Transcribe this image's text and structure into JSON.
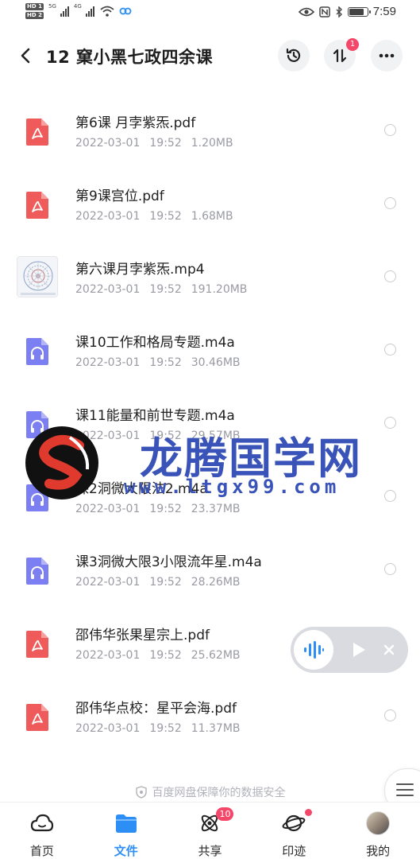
{
  "status_bar": {
    "hd1": "HD 1",
    "hd2": "HD 2",
    "net1": "5G",
    "net2": "4G",
    "time": "7:59"
  },
  "header": {
    "title": "12 窠小黑七政四余课",
    "sort_badge": "1"
  },
  "files": [
    {
      "name": "第6课 月孛紫炁.pdf",
      "date": "2022-03-01",
      "time": "19:52",
      "size": "1.20MB",
      "type": "pdf"
    },
    {
      "name": "第9课宫位.pdf",
      "date": "2022-03-01",
      "time": "19:52",
      "size": "1.68MB",
      "type": "pdf"
    },
    {
      "name": "第六课月孛紫炁.mp4",
      "date": "2022-03-01",
      "time": "19:52",
      "size": "191.20MB",
      "type": "video"
    },
    {
      "name": "课10工作和格局专题.m4a",
      "date": "2022-03-01",
      "time": "19:52",
      "size": "30.46MB",
      "type": "audio"
    },
    {
      "name": "课11能量和前世专题.m4a",
      "date": "2022-03-01",
      "time": "19:52",
      "size": "29.57MB",
      "type": "audio"
    },
    {
      "name": "课2洞微大限法2.m4a",
      "date": "2022-03-01",
      "time": "19:52",
      "size": "23.37MB",
      "type": "audio"
    },
    {
      "name": "课3洞微大限3小限流年星.m4a",
      "date": "2022-03-01",
      "time": "19:52",
      "size": "28.26MB",
      "type": "audio"
    },
    {
      "name": "邵伟华张果星宗上.pdf",
      "date": "2022-03-01",
      "time": "19:52",
      "size": "25.62MB",
      "type": "pdf"
    },
    {
      "name": "邵伟华点校：星平会海.pdf",
      "date": "2022-03-01",
      "time": "19:52",
      "size": "11.37MB",
      "type": "pdf"
    }
  ],
  "watermark": {
    "text": "龙腾国学网",
    "url": "www.ltgx99.com"
  },
  "safety_note": "百度网盘保障你的数据安全",
  "nav": {
    "items": [
      {
        "label": "首页",
        "icon": "cloud-home-icon"
      },
      {
        "label": "文件",
        "icon": "folder-icon"
      },
      {
        "label": "共享",
        "icon": "share-orbit-icon",
        "badge": "10"
      },
      {
        "label": "印迹",
        "icon": "planet-icon"
      },
      {
        "label": "我的",
        "icon": "avatar"
      }
    ]
  },
  "colors": {
    "accent": "#2d8ef6",
    "pdf": "#ef5a5a",
    "audio": "#7c7ff2",
    "badge": "#f5476a"
  }
}
